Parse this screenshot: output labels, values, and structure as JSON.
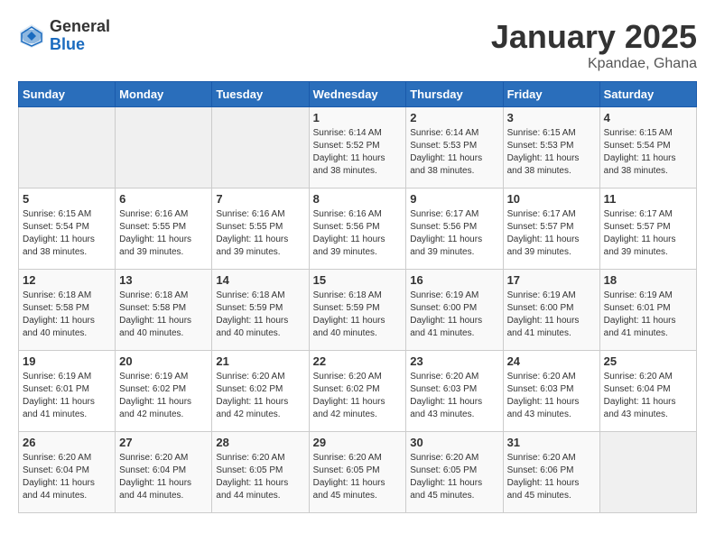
{
  "logo": {
    "general": "General",
    "blue": "Blue"
  },
  "title": "January 2025",
  "subtitle": "Kpandae, Ghana",
  "weekdays": [
    "Sunday",
    "Monday",
    "Tuesday",
    "Wednesday",
    "Thursday",
    "Friday",
    "Saturday"
  ],
  "weeks": [
    [
      {
        "day": "",
        "sunrise": "",
        "sunset": "",
        "daylight": ""
      },
      {
        "day": "",
        "sunrise": "",
        "sunset": "",
        "daylight": ""
      },
      {
        "day": "",
        "sunrise": "",
        "sunset": "",
        "daylight": ""
      },
      {
        "day": "1",
        "sunrise": "Sunrise: 6:14 AM",
        "sunset": "Sunset: 5:52 PM",
        "daylight": "Daylight: 11 hours and 38 minutes."
      },
      {
        "day": "2",
        "sunrise": "Sunrise: 6:14 AM",
        "sunset": "Sunset: 5:53 PM",
        "daylight": "Daylight: 11 hours and 38 minutes."
      },
      {
        "day": "3",
        "sunrise": "Sunrise: 6:15 AM",
        "sunset": "Sunset: 5:53 PM",
        "daylight": "Daylight: 11 hours and 38 minutes."
      },
      {
        "day": "4",
        "sunrise": "Sunrise: 6:15 AM",
        "sunset": "Sunset: 5:54 PM",
        "daylight": "Daylight: 11 hours and 38 minutes."
      }
    ],
    [
      {
        "day": "5",
        "sunrise": "Sunrise: 6:15 AM",
        "sunset": "Sunset: 5:54 PM",
        "daylight": "Daylight: 11 hours and 38 minutes."
      },
      {
        "day": "6",
        "sunrise": "Sunrise: 6:16 AM",
        "sunset": "Sunset: 5:55 PM",
        "daylight": "Daylight: 11 hours and 39 minutes."
      },
      {
        "day": "7",
        "sunrise": "Sunrise: 6:16 AM",
        "sunset": "Sunset: 5:55 PM",
        "daylight": "Daylight: 11 hours and 39 minutes."
      },
      {
        "day": "8",
        "sunrise": "Sunrise: 6:16 AM",
        "sunset": "Sunset: 5:56 PM",
        "daylight": "Daylight: 11 hours and 39 minutes."
      },
      {
        "day": "9",
        "sunrise": "Sunrise: 6:17 AM",
        "sunset": "Sunset: 5:56 PM",
        "daylight": "Daylight: 11 hours and 39 minutes."
      },
      {
        "day": "10",
        "sunrise": "Sunrise: 6:17 AM",
        "sunset": "Sunset: 5:57 PM",
        "daylight": "Daylight: 11 hours and 39 minutes."
      },
      {
        "day": "11",
        "sunrise": "Sunrise: 6:17 AM",
        "sunset": "Sunset: 5:57 PM",
        "daylight": "Daylight: 11 hours and 39 minutes."
      }
    ],
    [
      {
        "day": "12",
        "sunrise": "Sunrise: 6:18 AM",
        "sunset": "Sunset: 5:58 PM",
        "daylight": "Daylight: 11 hours and 40 minutes."
      },
      {
        "day": "13",
        "sunrise": "Sunrise: 6:18 AM",
        "sunset": "Sunset: 5:58 PM",
        "daylight": "Daylight: 11 hours and 40 minutes."
      },
      {
        "day": "14",
        "sunrise": "Sunrise: 6:18 AM",
        "sunset": "Sunset: 5:59 PM",
        "daylight": "Daylight: 11 hours and 40 minutes."
      },
      {
        "day": "15",
        "sunrise": "Sunrise: 6:18 AM",
        "sunset": "Sunset: 5:59 PM",
        "daylight": "Daylight: 11 hours and 40 minutes."
      },
      {
        "day": "16",
        "sunrise": "Sunrise: 6:19 AM",
        "sunset": "Sunset: 6:00 PM",
        "daylight": "Daylight: 11 hours and 41 minutes."
      },
      {
        "day": "17",
        "sunrise": "Sunrise: 6:19 AM",
        "sunset": "Sunset: 6:00 PM",
        "daylight": "Daylight: 11 hours and 41 minutes."
      },
      {
        "day": "18",
        "sunrise": "Sunrise: 6:19 AM",
        "sunset": "Sunset: 6:01 PM",
        "daylight": "Daylight: 11 hours and 41 minutes."
      }
    ],
    [
      {
        "day": "19",
        "sunrise": "Sunrise: 6:19 AM",
        "sunset": "Sunset: 6:01 PM",
        "daylight": "Daylight: 11 hours and 41 minutes."
      },
      {
        "day": "20",
        "sunrise": "Sunrise: 6:19 AM",
        "sunset": "Sunset: 6:02 PM",
        "daylight": "Daylight: 11 hours and 42 minutes."
      },
      {
        "day": "21",
        "sunrise": "Sunrise: 6:20 AM",
        "sunset": "Sunset: 6:02 PM",
        "daylight": "Daylight: 11 hours and 42 minutes."
      },
      {
        "day": "22",
        "sunrise": "Sunrise: 6:20 AM",
        "sunset": "Sunset: 6:02 PM",
        "daylight": "Daylight: 11 hours and 42 minutes."
      },
      {
        "day": "23",
        "sunrise": "Sunrise: 6:20 AM",
        "sunset": "Sunset: 6:03 PM",
        "daylight": "Daylight: 11 hours and 43 minutes."
      },
      {
        "day": "24",
        "sunrise": "Sunrise: 6:20 AM",
        "sunset": "Sunset: 6:03 PM",
        "daylight": "Daylight: 11 hours and 43 minutes."
      },
      {
        "day": "25",
        "sunrise": "Sunrise: 6:20 AM",
        "sunset": "Sunset: 6:04 PM",
        "daylight": "Daylight: 11 hours and 43 minutes."
      }
    ],
    [
      {
        "day": "26",
        "sunrise": "Sunrise: 6:20 AM",
        "sunset": "Sunset: 6:04 PM",
        "daylight": "Daylight: 11 hours and 44 minutes."
      },
      {
        "day": "27",
        "sunrise": "Sunrise: 6:20 AM",
        "sunset": "Sunset: 6:04 PM",
        "daylight": "Daylight: 11 hours and 44 minutes."
      },
      {
        "day": "28",
        "sunrise": "Sunrise: 6:20 AM",
        "sunset": "Sunset: 6:05 PM",
        "daylight": "Daylight: 11 hours and 44 minutes."
      },
      {
        "day": "29",
        "sunrise": "Sunrise: 6:20 AM",
        "sunset": "Sunset: 6:05 PM",
        "daylight": "Daylight: 11 hours and 45 minutes."
      },
      {
        "day": "30",
        "sunrise": "Sunrise: 6:20 AM",
        "sunset": "Sunset: 6:05 PM",
        "daylight": "Daylight: 11 hours and 45 minutes."
      },
      {
        "day": "31",
        "sunrise": "Sunrise: 6:20 AM",
        "sunset": "Sunset: 6:06 PM",
        "daylight": "Daylight: 11 hours and 45 minutes."
      },
      {
        "day": "",
        "sunrise": "",
        "sunset": "",
        "daylight": ""
      }
    ]
  ]
}
